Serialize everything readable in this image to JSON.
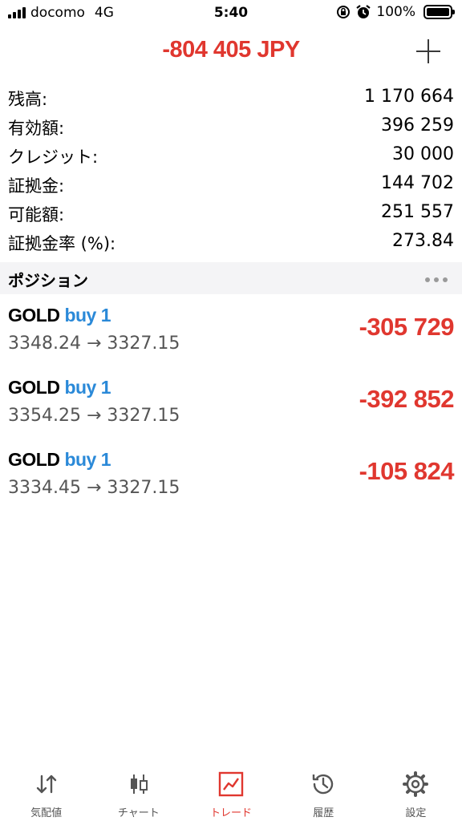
{
  "status_bar": {
    "carrier": "docomo",
    "network": "4G",
    "time": "5:40",
    "battery": "100%"
  },
  "header": {
    "title": "-804 405 JPY",
    "add_icon": "plus-icon"
  },
  "summary": {
    "rows": [
      {
        "label": "残高:",
        "value": "1 170 664"
      },
      {
        "label": "有効額:",
        "value": "396 259"
      },
      {
        "label": "クレジット:",
        "value": "30 000"
      },
      {
        "label": "証拠金:",
        "value": "144 702"
      },
      {
        "label": "可能額:",
        "value": "251 557"
      },
      {
        "label": "証拠金率 (%):",
        "value": "273.84"
      }
    ]
  },
  "positions_section": {
    "title": "ポジション",
    "more_icon": "ellipsis-icon"
  },
  "positions": [
    {
      "symbol": "GOLD",
      "side": "buy 1",
      "prices": "3348.24 → 3327.15",
      "profit": "-305 729"
    },
    {
      "symbol": "GOLD",
      "side": "buy 1",
      "prices": "3354.25 → 3327.15",
      "profit": "-392 852"
    },
    {
      "symbol": "GOLD",
      "side": "buy 1",
      "prices": "3334.45 → 3327.15",
      "profit": "-105 824"
    }
  ],
  "tabs": [
    {
      "label": "気配値",
      "icon": "quotes-arrows-icon",
      "active": false
    },
    {
      "label": "チャート",
      "icon": "candlestick-icon",
      "active": false
    },
    {
      "label": "トレード",
      "icon": "trade-chart-icon",
      "active": true
    },
    {
      "label": "履歴",
      "icon": "history-clock-icon",
      "active": false
    },
    {
      "label": "設定",
      "icon": "gear-icon",
      "active": false
    }
  ],
  "colors": {
    "accent_red": "#e0372f",
    "buy_blue": "#2a89d8",
    "section_bg": "#f4f4f6"
  }
}
